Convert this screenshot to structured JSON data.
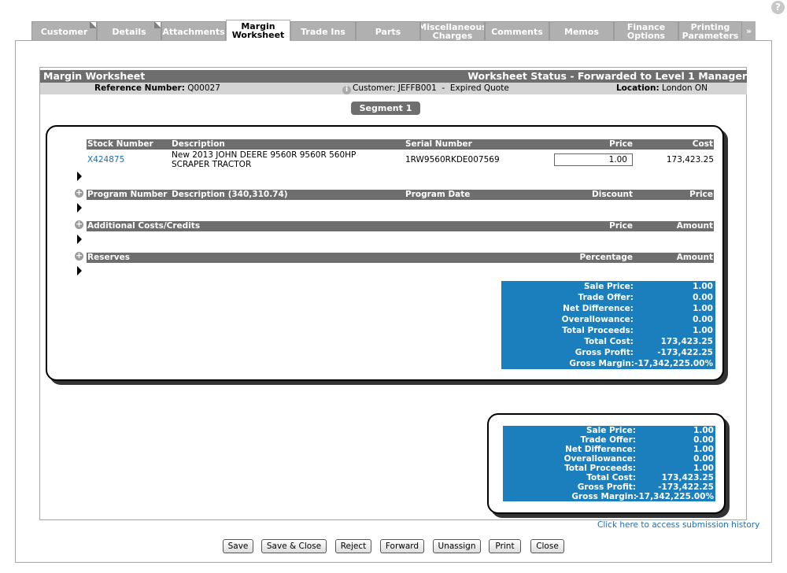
{
  "help": {
    "icon": "help-icon",
    "glyph": "?"
  },
  "tabs": [
    {
      "label": "Customer"
    },
    {
      "label": "Details"
    },
    {
      "label": "Attachments"
    },
    {
      "label": "Margin Worksheet"
    },
    {
      "label": "Trade Ins"
    },
    {
      "label": "Parts"
    },
    {
      "label": "Miscellaneous Charges"
    },
    {
      "label": "Comments"
    },
    {
      "label": "Memos"
    },
    {
      "label": "Finance Options"
    },
    {
      "label": "Printing Parameters"
    }
  ],
  "tab_more": "»",
  "header": {
    "title": "Margin Worksheet",
    "status": "Worksheet Status - Forwarded to Level 1 Manager"
  },
  "ref_bar": {
    "ref_label": "Reference Number:",
    "ref_value": "Q00027",
    "customer_text": "Customer: JEFFB001  -  Expired Quote",
    "location_label": "Location:",
    "location_value": "London ON"
  },
  "segment_label": "Segment 1",
  "stock_table": {
    "headers": {
      "stock": "Stock Number",
      "description": "Description",
      "serial": "Serial Number",
      "price": "Price",
      "cost": "Cost"
    },
    "row": {
      "stock": "X424875",
      "description": "New 2013 JOHN DEERE 9560R 9560R 560HP SCRAPER TRACTOR",
      "serial": "1RW9560RKDE007569",
      "price": "1.00",
      "cost": "173,423.25"
    }
  },
  "program_table": {
    "headers": {
      "number": "Program Number",
      "description": "Description (340,310.74)",
      "date": "Program Date",
      "discount": "Discount",
      "price": "Price"
    }
  },
  "additional_table": {
    "headers": {
      "title": "Additional Costs/Credits",
      "price": "Price",
      "amount": "Amount"
    }
  },
  "reserves_table": {
    "headers": {
      "title": "Reserves",
      "percentage": "Percentage",
      "amount": "Amount"
    }
  },
  "summary_labels": {
    "sale_price": "Sale Price:",
    "trade_offer": "Trade Offer:",
    "net_difference": "Net Difference:",
    "overallowance": "Overallowance:",
    "total_proceeds": "Total Proceeds:",
    "total_cost": "Total Cost:",
    "gross_profit": "Gross Profit:",
    "gross_margin": "Gross Margin:"
  },
  "segment_summary": {
    "sale_price": "1.00",
    "trade_offer": "0.00",
    "net_difference": "1.00",
    "overallowance": "0.00",
    "total_proceeds": "1.00",
    "total_cost": "173,423.25",
    "gross_profit": "-173,422.25",
    "gross_margin": "-17,342,225.00%"
  },
  "total_summary": {
    "sale_price": "1.00",
    "trade_offer": "0.00",
    "net_difference": "1.00",
    "overallowance": "0.00",
    "total_proceeds": "1.00",
    "total_cost": "173,423.25",
    "gross_profit": "-173,422.25",
    "gross_margin": "-17,342,225.00%"
  },
  "history_link": "Click here to access submission history",
  "buttons": {
    "save": "Save",
    "save_close": "Save & Close",
    "reject": "Reject",
    "forward": "Forward",
    "unassign": "Unassign",
    "print": "Print",
    "close": "Close"
  },
  "colors": {
    "summary_blue": "#1b7fbd",
    "header_gray": "#6e6e6e",
    "link_blue": "#1a6eb5"
  }
}
